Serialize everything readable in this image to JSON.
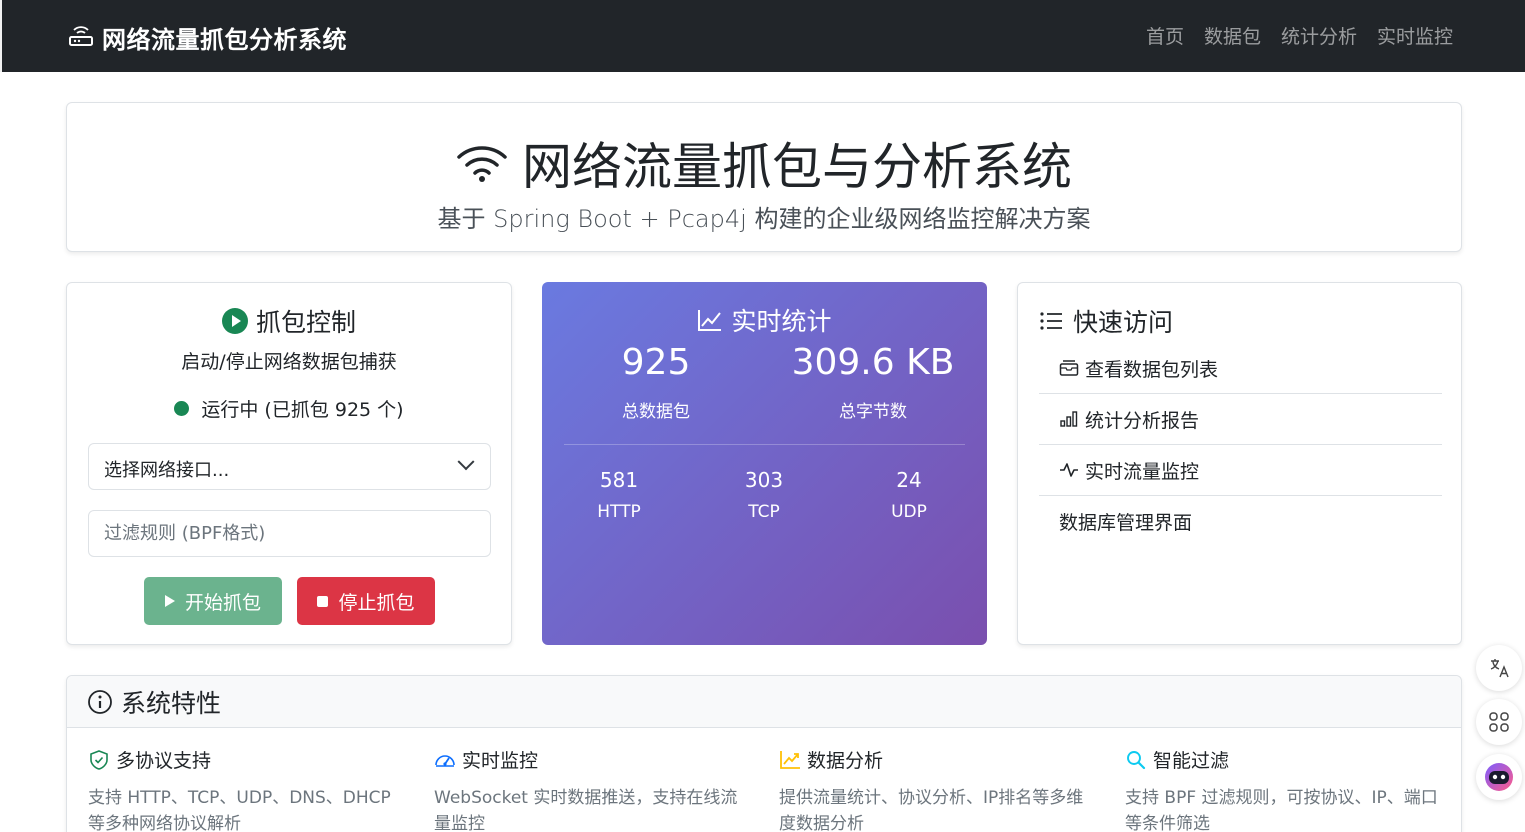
{
  "navbar": {
    "brand": "网络流量抓包分析系统",
    "links": [
      "首页",
      "数据包",
      "统计分析",
      "实时监控"
    ]
  },
  "hero": {
    "title": "网络流量抓包与分析系统",
    "subtitle": "基于 Spring Boot + Pcap4j 构建的企业级网络监控解决方案"
  },
  "control": {
    "title": "抓包控制",
    "description": "启动/停止网络数据包捕获",
    "status": "运行中 (已抓包 925 个)",
    "status_color": "#198754",
    "interface_select": "选择网络接口...",
    "filter_placeholder": "过滤规则 (BPF格式)",
    "start_label": "开始抓包",
    "stop_label": "停止抓包"
  },
  "stats": {
    "title": "实时统计",
    "total_packets": "925",
    "total_packets_label": "总数据包",
    "total_bytes": "309.6 KB",
    "total_bytes_label": "总字节数",
    "protocols": [
      {
        "value": "581",
        "label": "HTTP"
      },
      {
        "value": "303",
        "label": "TCP"
      },
      {
        "value": "24",
        "label": "UDP"
      }
    ],
    "gradient": [
      "#6a7ae0",
      "#7a4fae"
    ]
  },
  "quick_access": {
    "title": "快速访问",
    "items": [
      {
        "label": "查看数据包列表",
        "icon": "inbox-icon"
      },
      {
        "label": "统计分析报告",
        "icon": "bar-chart-icon"
      },
      {
        "label": "实时流量监控",
        "icon": "activity-icon"
      },
      {
        "label": "数据库管理界面",
        "icon": ""
      }
    ]
  },
  "features": {
    "title": "系统特性",
    "items": [
      {
        "title": "多协议支持",
        "desc": "支持 HTTP、TCP、UDP、DNS、DHCP 等多种网络协议解析",
        "icon": "shield-check-icon",
        "color": "#198754"
      },
      {
        "title": "实时监控",
        "desc": "WebSocket 实时数据推送，支持在线流量监控",
        "icon": "speedometer-icon",
        "color": "#0d6efd"
      },
      {
        "title": "数据分析",
        "desc": "提供流量统计、协议分析、IP排名等多维度数据分析",
        "icon": "graph-up-icon",
        "color": "#ffc107"
      },
      {
        "title": "智能过滤",
        "desc": "支持 BPF 过滤规则，可按协议、IP、端口等条件筛选",
        "icon": "search-icon",
        "color": "#0dcaf0"
      }
    ]
  }
}
